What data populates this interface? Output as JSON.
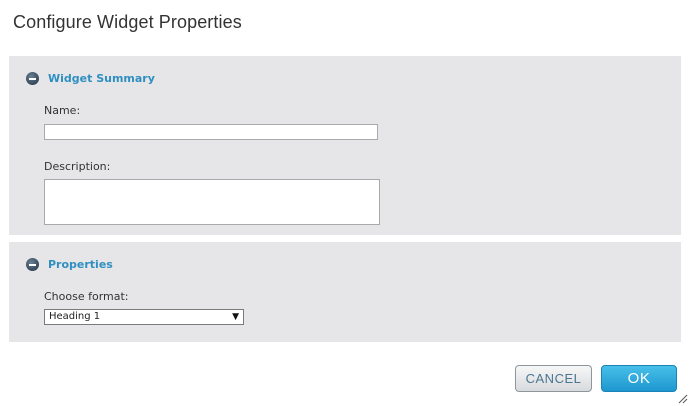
{
  "dialog": {
    "title": "Configure Widget Properties"
  },
  "widget_summary": {
    "title": "Widget Summary",
    "name_label": "Name:",
    "name_value": "",
    "description_label": "Description:",
    "description_value": ""
  },
  "properties": {
    "title": "Properties",
    "format_label": "Choose format:",
    "format_selected": "Heading 1"
  },
  "buttons": {
    "cancel_label": "CANCEL",
    "ok_label": "OK"
  },
  "colors": {
    "section_title": "#2f8fc0",
    "ok_button": "#1d97cf",
    "panel_bg": "#e6e6e9"
  }
}
